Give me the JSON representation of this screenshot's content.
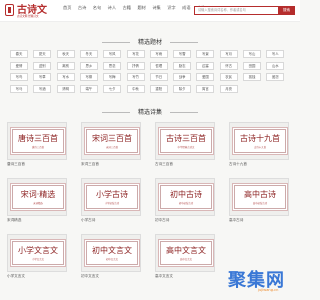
{
  "header": {
    "logo_title": "古诗文",
    "logo_subtitle": "古诗文网 经典诗文",
    "nav": [
      "首页",
      "古诗",
      "名句",
      "诗人",
      "古籍",
      "题材",
      "诗集",
      "识字",
      "成语",
      "查询"
    ],
    "search_placeholder": "请输入搜索诗词名称、作者或名句",
    "search_button": "搜索"
  },
  "section_topics": {
    "title": "精选题材",
    "tags": [
      "春天",
      "夏天",
      "秋天",
      "冬天",
      "写风",
      "写花",
      "写雨",
      "写雪",
      "写景",
      "写月",
      "写山",
      "写人",
      "爱情",
      "送别",
      "离别",
      "思乡",
      "思念",
      "抒情",
      "哲理",
      "励志",
      "边塞",
      "怀古",
      "田园",
      "山水",
      "写鸟",
      "写草",
      "写水",
      "写柳",
      "写梅",
      "写竹",
      "节日",
      "战争",
      "爱国",
      "农民",
      "孤独",
      "闺怨",
      "写马",
      "写酒",
      "清明",
      "端午",
      "七夕",
      "中秋",
      "重阳",
      "除夕",
      "寓言",
      "月亮"
    ]
  },
  "section_collections": {
    "title": "精选诗集",
    "items": [
      {
        "art_title": "唐诗三百首",
        "art_sub": "唐诗三百首",
        "caption": "唐诗三百首"
      },
      {
        "art_title": "宋词三百首",
        "art_sub": "宋词三百首",
        "caption": "宋词三百首"
      },
      {
        "art_title": "古诗三百首",
        "art_sub": "中华经典古诗文",
        "caption": "古诗三百首"
      },
      {
        "art_title": "古诗十九首",
        "art_sub": "古诗十九首",
        "caption": "古诗十九首"
      },
      {
        "art_title": "宋词·精选",
        "art_sub": "宋词精选",
        "caption": "宋词精选"
      },
      {
        "art_title": "小学古诗",
        "art_sub": "小学必背古诗",
        "caption": "小学古诗"
      },
      {
        "art_title": "初中古诗",
        "art_sub": "初中必背古诗",
        "caption": "初中古诗"
      },
      {
        "art_title": "高中古诗",
        "art_sub": "高中必背古诗",
        "caption": "高中古诗"
      },
      {
        "art_title": "小学文言文",
        "art_sub": "小学文言文",
        "caption": "小学文言文"
      },
      {
        "art_title": "初中文言文",
        "art_sub": "初中文言文",
        "caption": "初中文言文"
      },
      {
        "art_title": "高中文言文",
        "art_sub": "高中文言文",
        "caption": "高中文言文"
      }
    ]
  },
  "watermark": {
    "text": "聚集网",
    "sub": "jujiwang.cn"
  },
  "colors": {
    "accent": "#b52d2d",
    "card_title": "#8b1f1f",
    "watermark_blue": "#3a78d6",
    "watermark_orange": "#ee8a2a"
  }
}
